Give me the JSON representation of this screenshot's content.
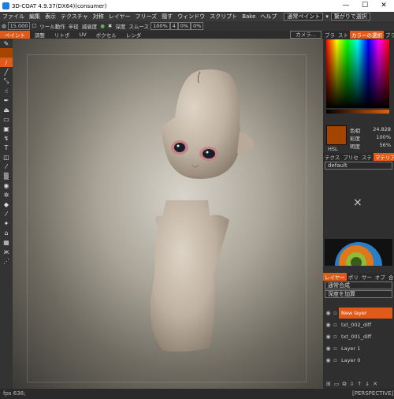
{
  "window": {
    "title": "3D-COAT 4.9.37(DX64)(consumer)",
    "minimize": "—",
    "maximize": "☐",
    "close": "✕"
  },
  "menu": [
    "ファイル",
    "編集",
    "表示",
    "テクスチャ",
    "対称",
    "レイヤー",
    "フリーズ",
    "隠す",
    "ウィンドウ",
    "スクリプト",
    "Bake",
    "ヘルプ"
  ],
  "menu_right": {
    "paint_mode": "通常ペイント",
    "select_mode": "繋がりで選択"
  },
  "toolbar": {
    "size_value": "15.000",
    "tool_action": "ツール動作",
    "radius": "半径",
    "depth_degree": "減衰度",
    "depth": "深度",
    "smooth": "スムース",
    "opacity": "100%",
    "value1": "4",
    "value2": "0%",
    "value3": "0%"
  },
  "rooms": [
    "ペイント",
    "調整",
    "リトポ",
    "UV",
    "ボクセル",
    "レンダ"
  ],
  "active_room": "ペイント",
  "camera_label": "カメラ...",
  "right_tabs_top": [
    "ブラ",
    "スト",
    "カラーの選択",
    "ブラ"
  ],
  "color": {
    "hsl_label": "HSL",
    "hue_label": "色相",
    "hue_value": "24.828",
    "sat_label": "彩度",
    "sat_value": "100%",
    "light_label": "明度",
    "light_value": "56%",
    "swatch_hex": "#a34500"
  },
  "material_tabs": [
    "テクス",
    "プリセ",
    "ステ",
    "マテリアル"
  ],
  "material_preset": "default",
  "empty_slot": "×",
  "layer_tabs": [
    "レイヤー",
    "ポリ",
    "サー",
    "オブ",
    "合"
  ],
  "blend_mode": "通常合成",
  "depth_mode": "深度を加算",
  "layers": [
    {
      "name": "New layer",
      "active": true
    },
    {
      "name": "txt_002_diff",
      "active": false
    },
    {
      "name": "txt_001_diff",
      "active": false
    },
    {
      "name": "Layer 1",
      "active": false
    },
    {
      "name": "Layer 0",
      "active": false
    }
  ],
  "status": {
    "fps": "fps 638;",
    "view": "[PERSPECTIVE]"
  },
  "colors": {
    "accent": "#e05a1a"
  }
}
